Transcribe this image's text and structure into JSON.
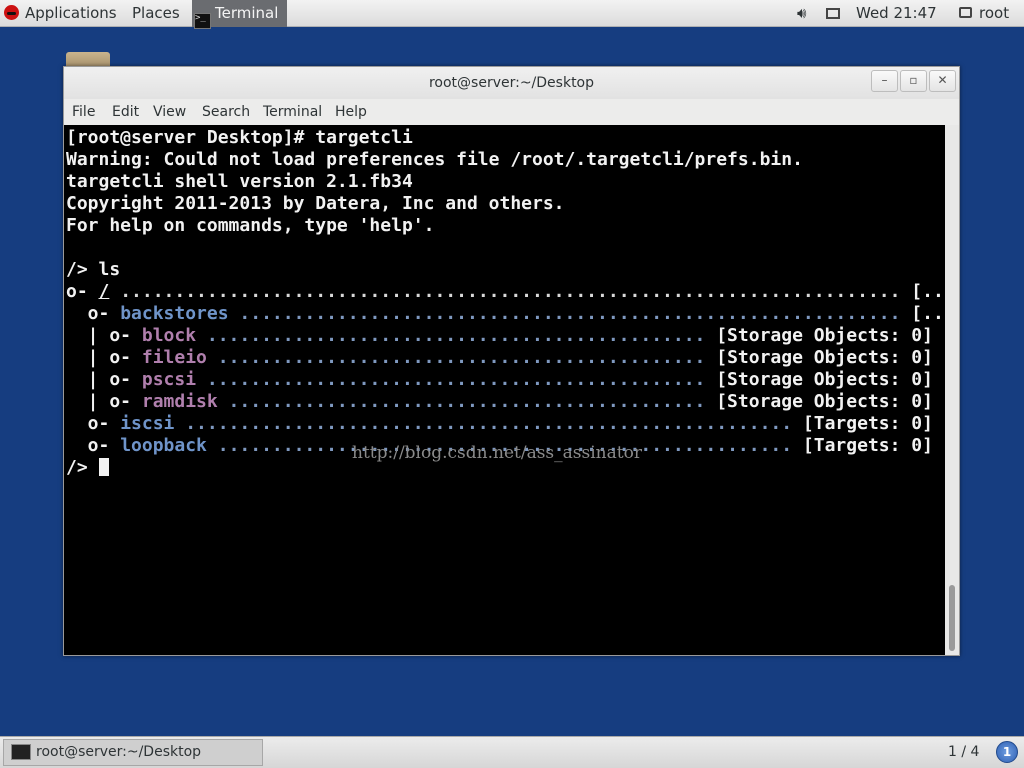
{
  "top_panel": {
    "applications_label": "Applications",
    "places_label": "Places",
    "active_app_label": "Terminal",
    "clock": "Wed 21:47",
    "user": "root"
  },
  "window": {
    "title": "root@server:~/Desktop",
    "controls": {
      "minimize": "–",
      "maximize": "▫",
      "close": "✕"
    },
    "menu": [
      "File",
      "Edit",
      "View",
      "Search",
      "Terminal",
      "Help"
    ]
  },
  "terminal": {
    "lines": [
      {
        "text": "[root@server Desktop]# targetcli"
      },
      {
        "text": "Warning: Could not load preferences file /root/.targetcli/prefs.bin."
      },
      {
        "text": "targetcli shell version 2.1.fb34"
      },
      {
        "text": "Copyright 2011-2013 by Datera, Inc and others."
      },
      {
        "text": "For help on commands, type 'help'."
      },
      {
        "text": ""
      },
      {
        "text": "/> ls"
      }
    ],
    "tree": [
      {
        "prefix": "o- ",
        "name": "/",
        "dots": " ........................................................................ ",
        "status": "[...]"
      },
      {
        "prefix": "  o- ",
        "name": "backstores",
        "dots": " ............................................................. ",
        "status": "[...]"
      },
      {
        "prefix": "  | o- ",
        "name": "block",
        "dots": " .............................................. ",
        "status": "[Storage Objects: 0]"
      },
      {
        "prefix": "  | o- ",
        "name": "fileio",
        "dots": " ............................................. ",
        "status": "[Storage Objects: 0]"
      },
      {
        "prefix": "  | o- ",
        "name": "pscsi",
        "dots": " .............................................. ",
        "status": "[Storage Objects: 0]"
      },
      {
        "prefix": "  | o- ",
        "name": "ramdisk",
        "dots": " ............................................ ",
        "status": "[Storage Objects: 0]"
      },
      {
        "prefix": "  o- ",
        "name": "iscsi",
        "dots": " ........................................................ ",
        "status": "[Targets: 0]"
      },
      {
        "prefix": "  o- ",
        "name": "loopback",
        "dots": " ..................................................... ",
        "status": "[Targets: 0]"
      }
    ],
    "prompt": "/> ",
    "watermark": "http://blog.csdn.net/ass_assinator"
  },
  "bottom_panel": {
    "task_label": "root@server:~/Desktop",
    "workspace": "1 / 4",
    "notification_count": "1"
  },
  "colors": {
    "desktop_bg": "#163d80",
    "terminal_bg": "#000000",
    "tree_blue": "#6f94c9",
    "tree_magenta": "#b07fad"
  }
}
